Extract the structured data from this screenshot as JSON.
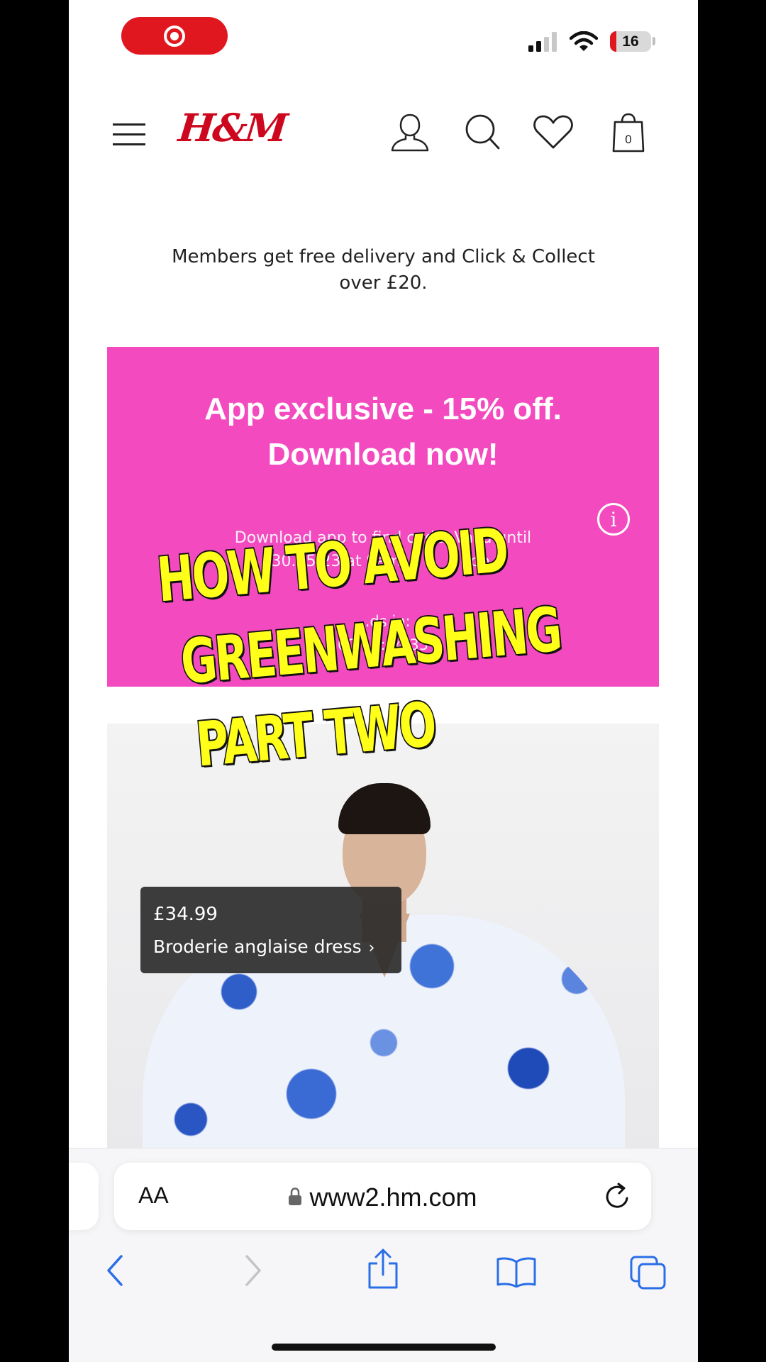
{
  "status_bar": {
    "battery": "16",
    "colors": {
      "recording": "#e0171e"
    },
    "icons": [
      "record-icon",
      "signal-icon",
      "wifi-icon",
      "battery-icon"
    ]
  },
  "header": {
    "logo": "H&M",
    "icons": [
      "menu-icon",
      "account-icon",
      "search-icon",
      "favorites-icon",
      "bag-icon"
    ],
    "bag_count": "0"
  },
  "promo": {
    "line1": "Members get free delivery and Click & Collect",
    "line2": "over £20."
  },
  "banner": {
    "title": "App exclusive - 15% off. Download now!",
    "sub_line1": "Download app to find code. Valid until",
    "sub_line2": "30.05.23 at 9am",
    "sub_line2_end": "pp.",
    "timer_label": "...ds in:",
    "timer_value": "00:12:04:35",
    "background_color": "#f34bbf"
  },
  "overlay_caption": {
    "line1": "HOW TO AVOID",
    "line2": "GREENWASHING",
    "line3": "PART TWO",
    "color": "#ffff1a"
  },
  "product": {
    "price": "£34.99",
    "name": "Broderie anglaise dress",
    "arrow": "›"
  },
  "browser": {
    "text_size_label": "AA",
    "url": "www2.hm.com",
    "icons": [
      "lock-icon",
      "reload-icon",
      "back-icon",
      "forward-icon",
      "share-icon",
      "bookmarks-icon",
      "tabs-icon"
    ]
  }
}
